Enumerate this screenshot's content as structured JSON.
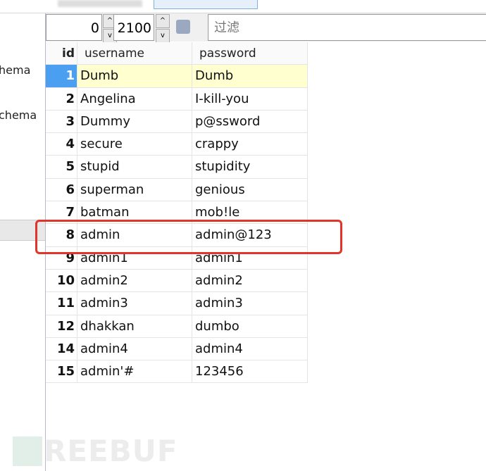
{
  "toolbar": {
    "offset": "0",
    "limit": "2100",
    "filter_placeholder": "过滤"
  },
  "left_panel": {
    "items": [
      "hema",
      "chema"
    ]
  },
  "table": {
    "columns": [
      "id",
      "username",
      "password"
    ],
    "rows": [
      [
        "1",
        "Dumb",
        "Dumb"
      ],
      [
        "2",
        "Angelina",
        "I-kill-you"
      ],
      [
        "3",
        "Dummy",
        "p@ssword"
      ],
      [
        "4",
        "secure",
        "crappy"
      ],
      [
        "5",
        "stupid",
        "stupidity"
      ],
      [
        "6",
        "superman",
        "genious"
      ],
      [
        "7",
        "batman",
        "mob!le"
      ],
      [
        "8",
        "admin",
        "admin@123"
      ],
      [
        "9",
        "admin1",
        "admin1"
      ],
      [
        "10",
        "admin2",
        "admin2"
      ],
      [
        "11",
        "admin3",
        "admin3"
      ],
      [
        "12",
        "dhakkan",
        "dumbo"
      ],
      [
        "14",
        "admin4",
        "admin4"
      ],
      [
        "15",
        "admin'#",
        "123456"
      ]
    ]
  },
  "watermark": "FREEBUF",
  "colors": {
    "highlight": "#e0352b",
    "selected": "#4a9ff0"
  }
}
